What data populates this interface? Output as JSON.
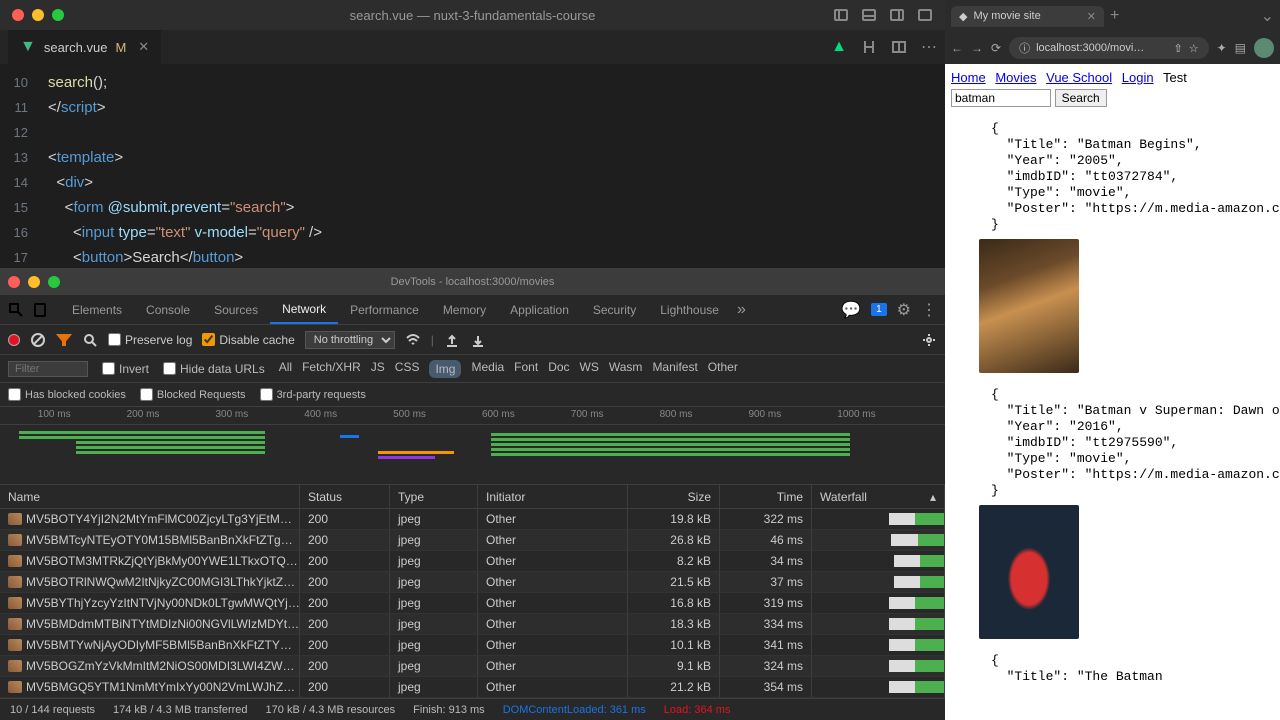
{
  "editor": {
    "title": "search.vue — nuxt-3-fundamentals-course",
    "tab": {
      "filename": "search.vue",
      "modified_marker": "M"
    },
    "code_lines": [
      {
        "num": 10,
        "html": "<span class='tok-func'>search</span>();"
      },
      {
        "num": 11,
        "html": "&lt;/<span class='tok-tag'>script</span>&gt;"
      },
      {
        "num": 12,
        "html": ""
      },
      {
        "num": 13,
        "html": "&lt;<span class='tok-tag'>template</span>&gt;"
      },
      {
        "num": 14,
        "html": "  &lt;<span class='tok-tag'>div</span>&gt;"
      },
      {
        "num": 15,
        "html": "    &lt;<span class='tok-tag'>form</span> <span class='tok-attr'>@submit.prevent</span>=<span class='tok-string'>\"search\"</span>&gt;"
      },
      {
        "num": 16,
        "html": "      &lt;<span class='tok-tag'>input</span> <span class='tok-attr'>type</span>=<span class='tok-string'>\"text\"</span> <span class='tok-attr'>v-model</span>=<span class='tok-string'>\"query\"</span> /&gt;"
      },
      {
        "num": 17,
        "html": "      &lt;<span class='tok-tag'>button</span>&gt;Search&lt;/<span class='tok-tag'>button</span>&gt;"
      }
    ]
  },
  "devtools": {
    "title": "DevTools - localhost:3000/movies",
    "tabs": [
      "Elements",
      "Console",
      "Sources",
      "Network",
      "Performance",
      "Memory",
      "Application",
      "Security",
      "Lighthouse"
    ],
    "active_tab": "Network",
    "badge_count": "1",
    "toolbar": {
      "preserve_log": "Preserve log",
      "disable_cache": "Disable cache",
      "throttling": "No throttling"
    },
    "filter_placeholder": "Filter",
    "filter_invert": "Invert",
    "filter_hide": "Hide data URLs",
    "filter_types": [
      "All",
      "Fetch/XHR",
      "JS",
      "CSS",
      "Img",
      "Media",
      "Font",
      "Doc",
      "WS",
      "Wasm",
      "Manifest",
      "Other"
    ],
    "filter_active": "Img",
    "filters2": [
      "Has blocked cookies",
      "Blocked Requests",
      "3rd-party requests"
    ],
    "ticks": [
      "100 ms",
      "200 ms",
      "300 ms",
      "400 ms",
      "500 ms",
      "600 ms",
      "700 ms",
      "800 ms",
      "900 ms",
      "1000 ms"
    ],
    "columns": [
      "Name",
      "Status",
      "Type",
      "Initiator",
      "Size",
      "Time",
      "Waterfall"
    ],
    "rows": [
      {
        "name": "MV5BOTY4YjI2N2MtYmFlMC00ZjcyLTg3YjEtM…",
        "status": "200",
        "type": "jpeg",
        "initiator": "Other",
        "size": "19.8 kB",
        "time": "322 ms",
        "wf": [
          78,
          100
        ]
      },
      {
        "name": "MV5BMTcyNTEyOTY0M15BMl5BanBnXkFtZTg…",
        "status": "200",
        "type": "jpeg",
        "initiator": "Other",
        "size": "26.8 kB",
        "time": "46 ms",
        "wf": [
          80,
          100
        ]
      },
      {
        "name": "MV5BOTM3MTRkZjQtYjBkMy00YWE1LTkxOTQ…",
        "status": "200",
        "type": "jpeg",
        "initiator": "Other",
        "size": "8.2 kB",
        "time": "34 ms",
        "wf": [
          82,
          100
        ]
      },
      {
        "name": "MV5BOTRlNWQwM2ItNjkyZC00MGI3LThkYjktZ…",
        "status": "200",
        "type": "jpeg",
        "initiator": "Other",
        "size": "21.5 kB",
        "time": "37 ms",
        "wf": [
          82,
          100
        ]
      },
      {
        "name": "MV5BYThjYzcyYzItNTVjNy00NDk0LTgwMWQtYj…",
        "status": "200",
        "type": "jpeg",
        "initiator": "Other",
        "size": "16.8 kB",
        "time": "319 ms",
        "wf": [
          78,
          100
        ]
      },
      {
        "name": "MV5BMDdmMTBiNTYtMDIzNi00NGVlLWIzMDYt…",
        "status": "200",
        "type": "jpeg",
        "initiator": "Other",
        "size": "18.3 kB",
        "time": "334 ms",
        "wf": [
          78,
          100
        ]
      },
      {
        "name": "MV5BMTYwNjAyODIyMF5BMl5BanBnXkFtZTY…",
        "status": "200",
        "type": "jpeg",
        "initiator": "Other",
        "size": "10.1 kB",
        "time": "341 ms",
        "wf": [
          78,
          100
        ]
      },
      {
        "name": "MV5BOGZmYzVkMmItM2NiOS00MDI3LWI4ZW…",
        "status": "200",
        "type": "jpeg",
        "initiator": "Other",
        "size": "9.1 kB",
        "time": "324 ms",
        "wf": [
          78,
          100
        ]
      },
      {
        "name": "MV5BMGQ5YTM1NmMtYmIxYy00N2VmLWJhZ…",
        "status": "200",
        "type": "jpeg",
        "initiator": "Other",
        "size": "21.2 kB",
        "time": "354 ms",
        "wf": [
          78,
          100
        ]
      }
    ],
    "status_bar": {
      "requests": "10 / 144 requests",
      "transferred": "174 kB / 4.3 MB transferred",
      "resources": "170 kB / 4.3 MB resources",
      "finish": "Finish: 913 ms",
      "dom": "DOMContentLoaded: 361 ms",
      "load": "Load: 364 ms"
    }
  },
  "browser": {
    "tab_title": "My movie site",
    "url": "localhost:3000/movi…",
    "nav": [
      "Home",
      "Movies",
      "Vue School",
      "Login",
      "Test"
    ],
    "search_value": "batman",
    "search_button": "Search",
    "results": [
      {
        "Title": "Batman Begins",
        "Year": "2005",
        "imdbID": "tt0372784",
        "Type": "movie",
        "Poster": "https://m.media-amazon.co"
      },
      {
        "Title": "Batman v Superman: Dawn of",
        "Year": "2016",
        "imdbID": "tt2975590",
        "Type": "movie",
        "Poster": "https://m.media-amazon.co"
      }
    ],
    "third_title": "The Batman"
  }
}
